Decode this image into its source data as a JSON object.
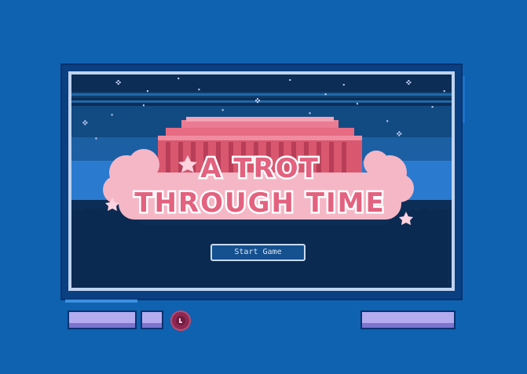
{
  "game": {
    "title_line1": "A TROT",
    "title_line2": "THROUGH TIME",
    "start_button_label": "Start Game"
  },
  "colors": {
    "background": "#0e62b0",
    "frame": "#0a3f82",
    "bezel": "#c0d3ee",
    "night_sky": "#0c2d55",
    "title_fill": "#e3627f",
    "title_outline": "#ffffff",
    "building": "#e66b83",
    "clouds": "#f5b7c6",
    "hud_bar": "#b5acf0",
    "hud_button": "#8e2852"
  },
  "icons": {
    "stars": "sparkle-star-icon",
    "hud_button": "record-button-icon"
  }
}
